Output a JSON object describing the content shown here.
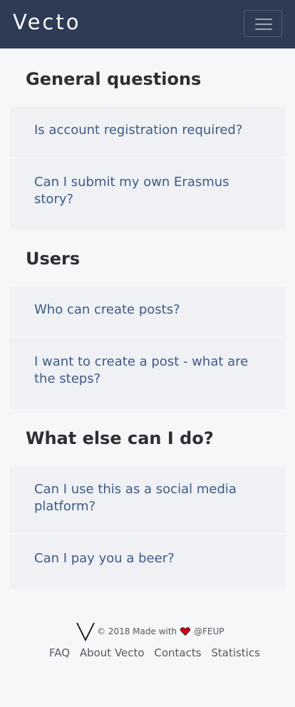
{
  "navbar": {
    "brand": "Vecto",
    "toggle_icon": "hamburger-menu-icon"
  },
  "sections": [
    {
      "title": "General questions",
      "questions": [
        "Is account registration required?",
        "Can I submit my own Erasmus story?"
      ]
    },
    {
      "title": "Users",
      "questions": [
        "Who can create posts?",
        "I want to create a post - what are the steps?"
      ]
    },
    {
      "title": "What else can I do?",
      "questions": [
        "Can I use this as a social media platform?",
        "Can I pay you a beer?"
      ]
    }
  ],
  "footer": {
    "copyright": "© 2018 Made with",
    "heart_icon": "heart-icon",
    "org": "@FEUP",
    "links": [
      "FAQ",
      "About Vecto",
      "Contacts",
      "Statistics"
    ],
    "heart_color": "#d0021b",
    "logo_icon": "vecto-logo-icon"
  },
  "colors": {
    "navbar": "#2d3b55",
    "background": "#f5f7f9",
    "card": "#eff1f4",
    "question_text": "#3f5a87",
    "heading_text": "#2c2f33"
  }
}
